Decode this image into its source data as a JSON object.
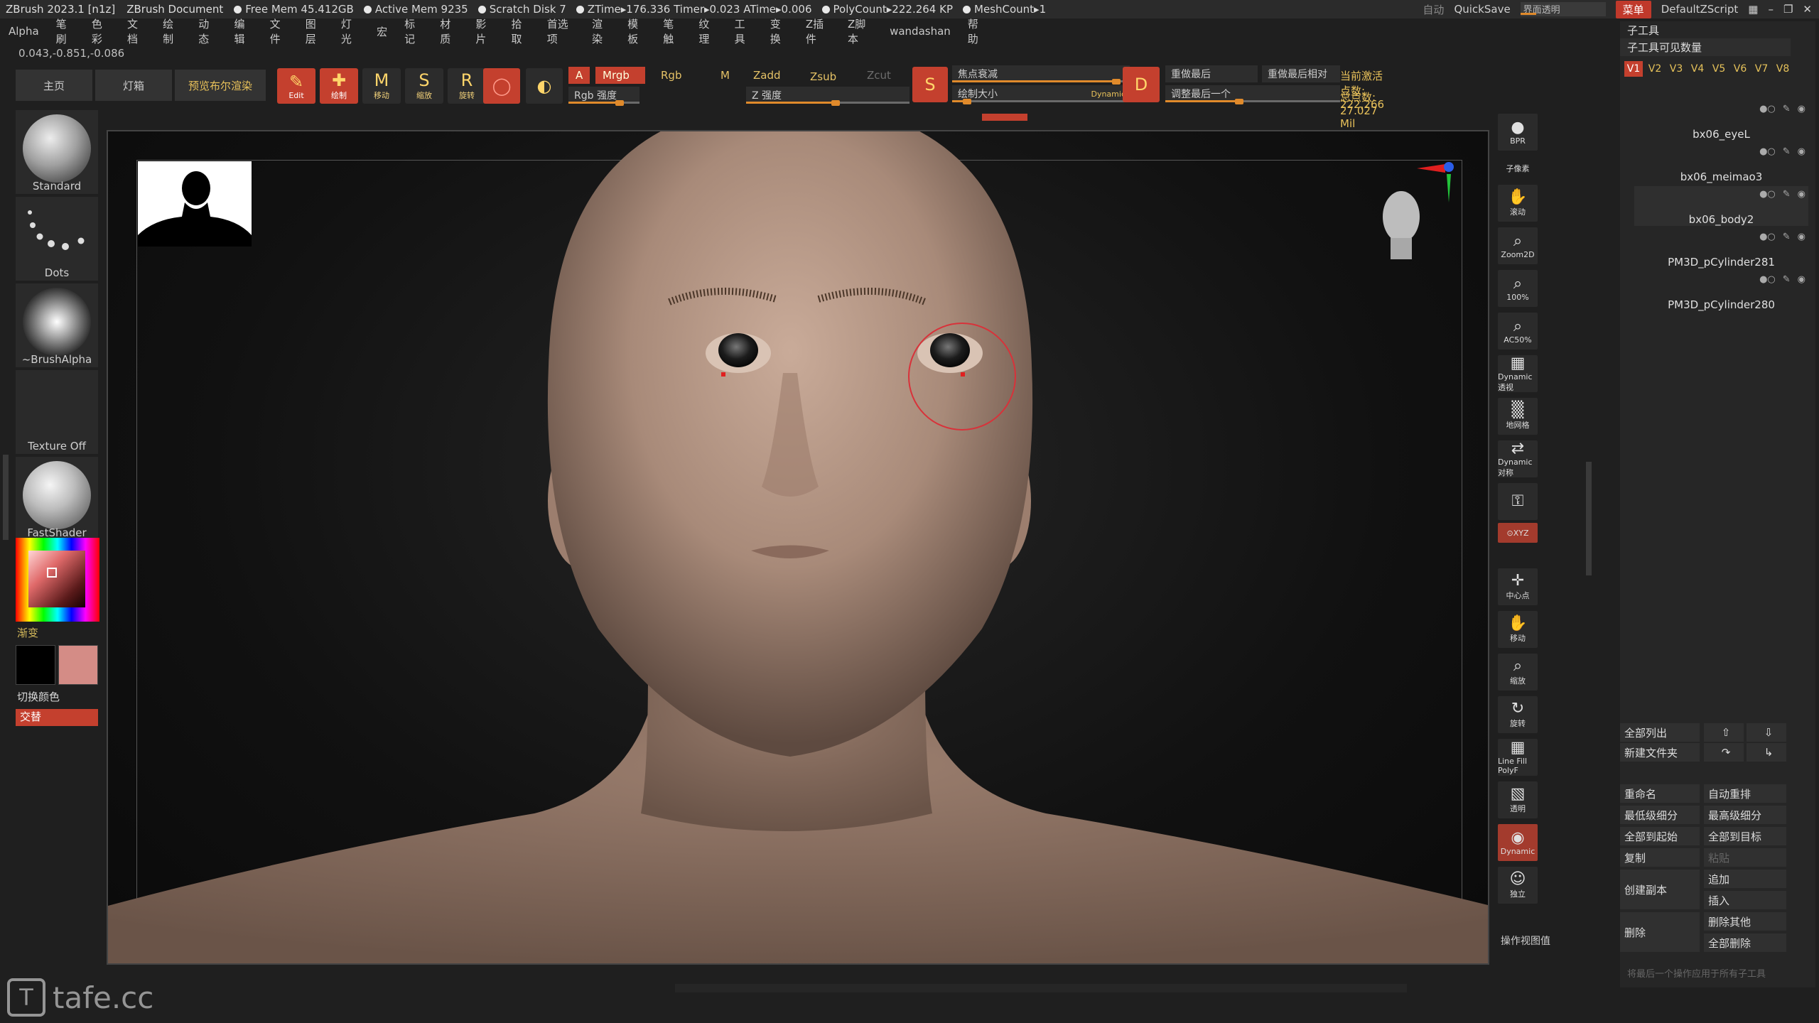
{
  "titlebar": {
    "app": "ZBrush 2023.1 [n1z]",
    "document": "ZBrush Document",
    "stats": [
      "Free Mem 45.412GB",
      "Active Mem 9235",
      "Scratch Disk 7",
      "ZTime▸176.336 Timer▸0.023 ATime▸0.006",
      "PolyCount▸222.264 KP",
      "MeshCount▸1"
    ],
    "auto": "自动",
    "quicksave": "QuickSave",
    "interface_transparency": "界面透明",
    "menus_btn": "菜单",
    "script": "DefaultZScript"
  },
  "menubar": [
    "Alpha",
    "笔刷",
    "色彩",
    "文档",
    "绘制",
    "动态",
    "编辑",
    "文件",
    "图层",
    "灯光",
    "宏",
    "标记",
    "材质",
    "影片",
    "拾取",
    "首选项",
    "渲染",
    "模板",
    "笔触",
    "纹理",
    "工具",
    "变换",
    "Z插件",
    "Z脚本",
    "wandashan",
    "帮助"
  ],
  "coords": "0.043,-0.851,-0.086",
  "toolbar": {
    "home": "主页",
    "lightbox": "灯箱",
    "bpr": "预览布尔渲染",
    "modes": [
      {
        "label": "Edit",
        "icon": "edit-icon",
        "glyph": "✎",
        "active": true
      },
      {
        "label": "绘制",
        "icon": "draw-icon",
        "glyph": "✚",
        "active": true
      },
      {
        "label": "移动",
        "icon": "move-icon",
        "glyph": "M",
        "active": false
      },
      {
        "label": "缩放",
        "icon": "scale-icon",
        "glyph": "S",
        "active": false
      },
      {
        "label": "旋转",
        "icon": "rotate-icon",
        "glyph": "R",
        "active": false
      }
    ],
    "a_toggle": "A",
    "mrgb": "Mrgb",
    "rgb": "Rgb",
    "m": "M",
    "zadd": "Zadd",
    "zsub": "Zsub",
    "zcut": "Zcut",
    "rgb_intensity": "Rgb 强度",
    "z_intensity": "Z 强度",
    "focal_shift": "焦点衰减",
    "draw_size": "绘制大小",
    "dynamic": "Dynamic",
    "replay_last": "重做最后",
    "replay_last_rel": "重做最后相对",
    "adjust_last": "调整最后一个",
    "active_points": "当前激活点数: 222,266",
    "total_points": "总点数: 27.027 Mil"
  },
  "leftshelf": {
    "brush": "Standard",
    "stroke": "Dots",
    "alpha": "~BrushAlpha",
    "texture": "Texture Off",
    "material": "FastShader",
    "gradient": "渐变",
    "switch_color": "切换颜色",
    "alternate": "交替",
    "main_color": "#000000",
    "secondary_color": "#d48c86"
  },
  "rightshelf": [
    {
      "label": "BPR",
      "icon": "bpr-icon",
      "glyph": "●"
    },
    {
      "label": "子像素",
      "icon": "subpixel-icon",
      "glyph": ""
    },
    {
      "label": "滚动",
      "icon": "scroll-icon",
      "glyph": "✋"
    },
    {
      "label": "Zoom2D",
      "icon": "zoom2d-icon",
      "glyph": "⌕"
    },
    {
      "label": "100%",
      "icon": "actual-size-icon",
      "glyph": "⌕"
    },
    {
      "label": "AC50%",
      "icon": "half-size-icon",
      "glyph": "⌕"
    },
    {
      "label": "Dynamic 透视",
      "icon": "perspective-icon",
      "glyph": "▦"
    },
    {
      "label": "地网格",
      "icon": "floor-grid-icon",
      "glyph": "▒"
    },
    {
      "label": "Dynamic 对称",
      "icon": "symmetry-icon",
      "glyph": "⇄"
    },
    {
      "label": "",
      "icon": "lock-icon",
      "glyph": "⚿"
    },
    {
      "label": "⊙XYZ",
      "icon": "xyz-icon",
      "glyph": ""
    },
    {
      "label": "中心点",
      "icon": "center-icon",
      "glyph": "✛"
    },
    {
      "label": "移动",
      "icon": "move-hand-icon",
      "glyph": "✋"
    },
    {
      "label": "缩放",
      "icon": "zoom-icon",
      "glyph": "⌕"
    },
    {
      "label": "旋转",
      "icon": "rotate-view-icon",
      "glyph": "↻"
    },
    {
      "label": "Line Fill PolyF",
      "icon": "polyframe-icon",
      "glyph": "▦"
    },
    {
      "label": "透明",
      "icon": "transparency-icon",
      "glyph": "▧"
    },
    {
      "label": "Dynamic",
      "icon": "ghost-icon",
      "glyph": "◉"
    },
    {
      "label": "独立",
      "icon": "solo-icon",
      "glyph": "☺"
    }
  ],
  "viewport_operation": "操作视图值",
  "subtool": {
    "title": "子工具",
    "visible_count": "子工具可见数量",
    "versions": [
      "V1",
      "V2",
      "V3",
      "V4",
      "V5",
      "V6",
      "V7",
      "V8"
    ],
    "items": [
      "bx06_eyeL",
      "bx06_meimao3",
      "bx06_body2",
      "PM3D_pCylinder281",
      "PM3D_pCylinder280"
    ],
    "buttons": {
      "list_all": "全部列出",
      "new_folder": "新建文件夹",
      "rename": "重命名",
      "auto_reorder": "自动重排",
      "lowest_subdiv": "最低级细分",
      "highest_subdiv": "最高级细分",
      "all_to_start": "全部到起始",
      "all_to_target": "全部到目标",
      "duplicate": "复制",
      "paste": "粘贴",
      "create_copy": "创建副本",
      "append": "追加",
      "insert": "插入",
      "delete": "删除",
      "delete_other": "删除其他",
      "delete_all": "全部删除",
      "footnote": "将最后一个操作应用于所有子工具"
    }
  },
  "watermark": "tafe.cc",
  "colors": {
    "accent": "#c4402e",
    "gold": "#e8c15a",
    "orange": "#e08a2b"
  }
}
